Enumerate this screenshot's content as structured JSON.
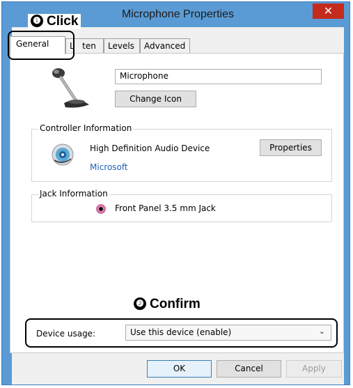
{
  "window": {
    "title": "Microphone Properties",
    "close_glyph": "✕"
  },
  "annotations": [
    {
      "number": "❶",
      "text": "Click"
    },
    {
      "number": "❷",
      "text": "Confirm"
    }
  ],
  "tabs": [
    {
      "label": "General",
      "active": true
    },
    {
      "label": "Listen",
      "active": false,
      "visible_text": "L   ten"
    },
    {
      "label": "Levels",
      "active": false
    },
    {
      "label": "Advanced",
      "active": false
    }
  ],
  "general": {
    "device_name": "Microphone",
    "change_icon_label": "Change Icon",
    "controller": {
      "group_label": "Controller Information",
      "device": "High Definition Audio Device",
      "vendor": "Microsoft",
      "properties_label": "Properties"
    },
    "jack": {
      "group_label": "Jack Information",
      "item": "Front Panel 3.5 mm Jack"
    },
    "device_usage": {
      "label": "Device usage:",
      "selected": "Use this device (enable)"
    }
  },
  "footer": {
    "ok_label": "OK",
    "cancel_label": "Cancel",
    "apply_label": "Apply"
  },
  "colors": {
    "titlebar": "#5b9bd5",
    "close": "#c42b1c",
    "link": "#1f5fb4",
    "jack": "#d66fa5"
  }
}
